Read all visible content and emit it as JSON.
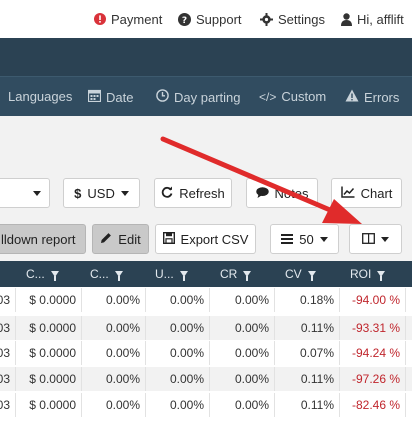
{
  "topbar": {
    "payment": "Payment",
    "support": "Support",
    "settings": "Settings",
    "user": "Hi, afflift"
  },
  "nav": {
    "languages": "Languages",
    "date": "Date",
    "day_parting": "Day parting",
    "custom": "Custom",
    "errors": "Errors"
  },
  "toolbar": {
    "currency": "USD",
    "refresh": "Refresh",
    "notes": "Notes",
    "chart": "Chart",
    "drilldown": "lldown report",
    "edit": "Edit",
    "export": "Export CSV",
    "per_page": "50"
  },
  "table": {
    "headers": [
      "C...",
      "C...",
      "U...",
      "CR",
      "CV",
      "ROI"
    ],
    "rows": [
      {
        "lead": "03",
        "cost": "$ 0.0000",
        "c2": "0.00%",
        "u": "0.00%",
        "cr": "0.00%",
        "cv": "0.18%",
        "roi": "-94.00 %"
      },
      {
        "lead": "03",
        "cost": "$ 0.0000",
        "c2": "0.00%",
        "u": "0.00%",
        "cr": "0.00%",
        "cv": "0.11%",
        "roi": "-93.31 %"
      },
      {
        "lead": "03",
        "cost": "$ 0.0000",
        "c2": "0.00%",
        "u": "0.00%",
        "cr": "0.00%",
        "cv": "0.07%",
        "roi": "-94.24 %"
      },
      {
        "lead": "03",
        "cost": "$ 0.0000",
        "c2": "0.00%",
        "u": "0.00%",
        "cr": "0.00%",
        "cv": "0.11%",
        "roi": "-97.26 %"
      },
      {
        "lead": "03",
        "cost": "$ 0.0000",
        "c2": "0.00%",
        "u": "0.00%",
        "cr": "0.00%",
        "cv": "0.11%",
        "roi": "-82.46 %"
      }
    ]
  },
  "colors": {
    "header_bg": "#2b4253",
    "nav_bg": "#314c60",
    "negative": "#c0262d",
    "arrow": "#e02b2b",
    "alert": "#d9323a"
  }
}
